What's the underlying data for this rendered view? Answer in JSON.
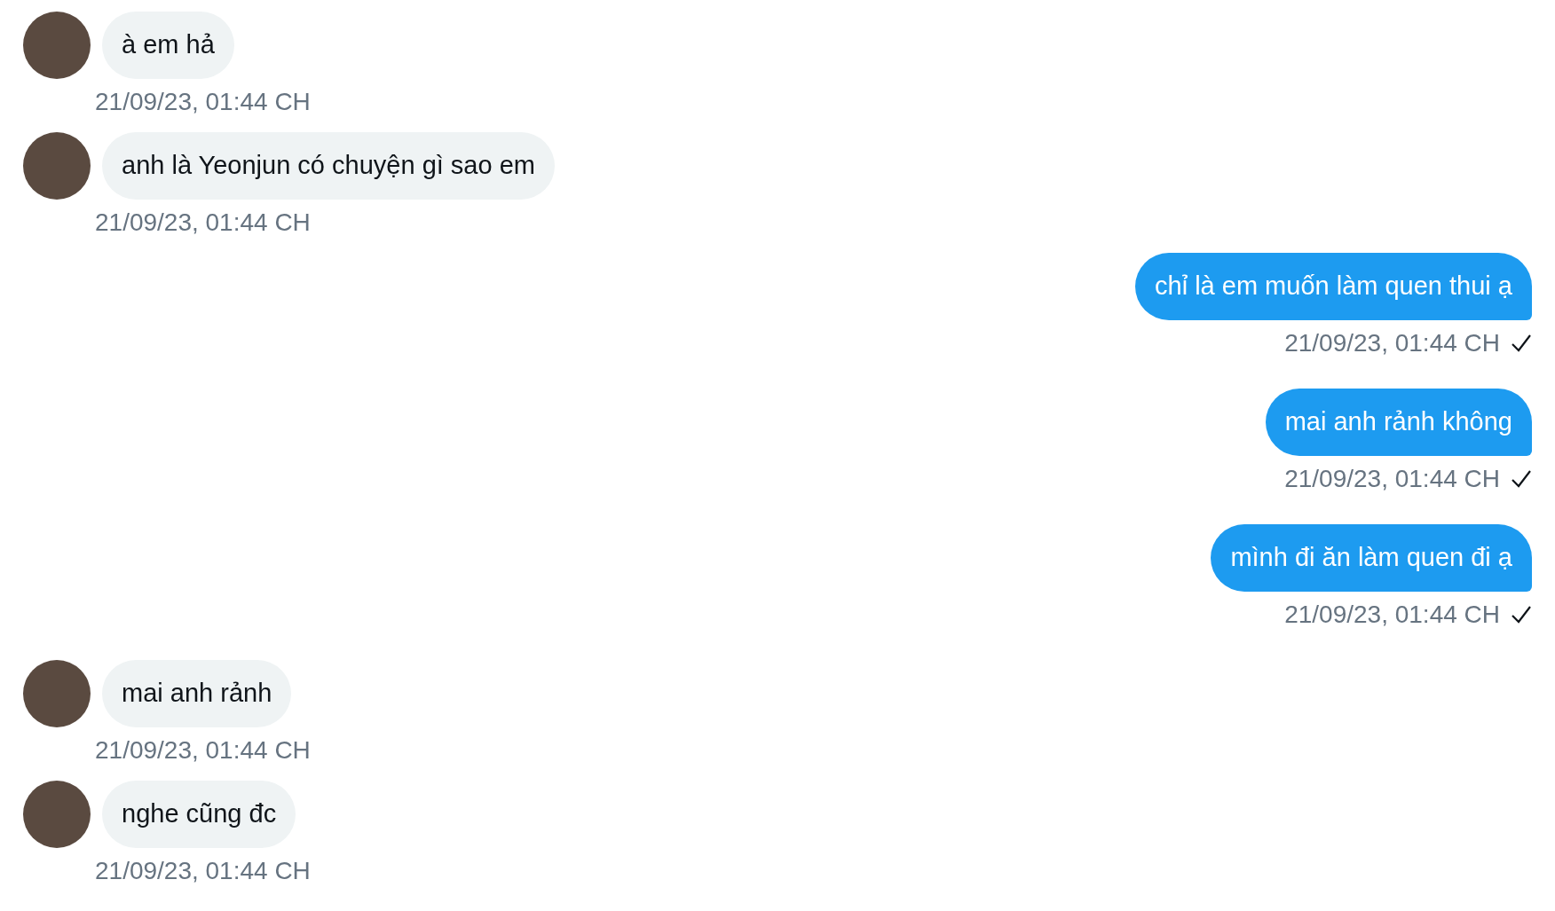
{
  "messages": [
    {
      "kind": "received",
      "text": "à em hả",
      "time": "21/09/23, 01:44 CH"
    },
    {
      "kind": "received",
      "text": "anh là Yeonjun có chuyện gì sao em",
      "time": "21/09/23, 01:44 CH"
    },
    {
      "kind": "sent",
      "text": "chỉ là em muốn làm quen thui ạ",
      "time": "21/09/23, 01:44 CH",
      "seen": true
    },
    {
      "kind": "sent",
      "text": "mai anh rảnh không",
      "time": "21/09/23, 01:44 CH",
      "seen": true
    },
    {
      "kind": "sent",
      "text": "mình đi ăn làm quen đi ạ",
      "time": "21/09/23, 01:44 CH",
      "seen": true
    },
    {
      "kind": "received",
      "text": "mai anh rảnh",
      "time": "21/09/23, 01:44 CH"
    },
    {
      "kind": "received",
      "text": "nghe cũng đc",
      "time": "21/09/23, 01:44 CH"
    }
  ]
}
